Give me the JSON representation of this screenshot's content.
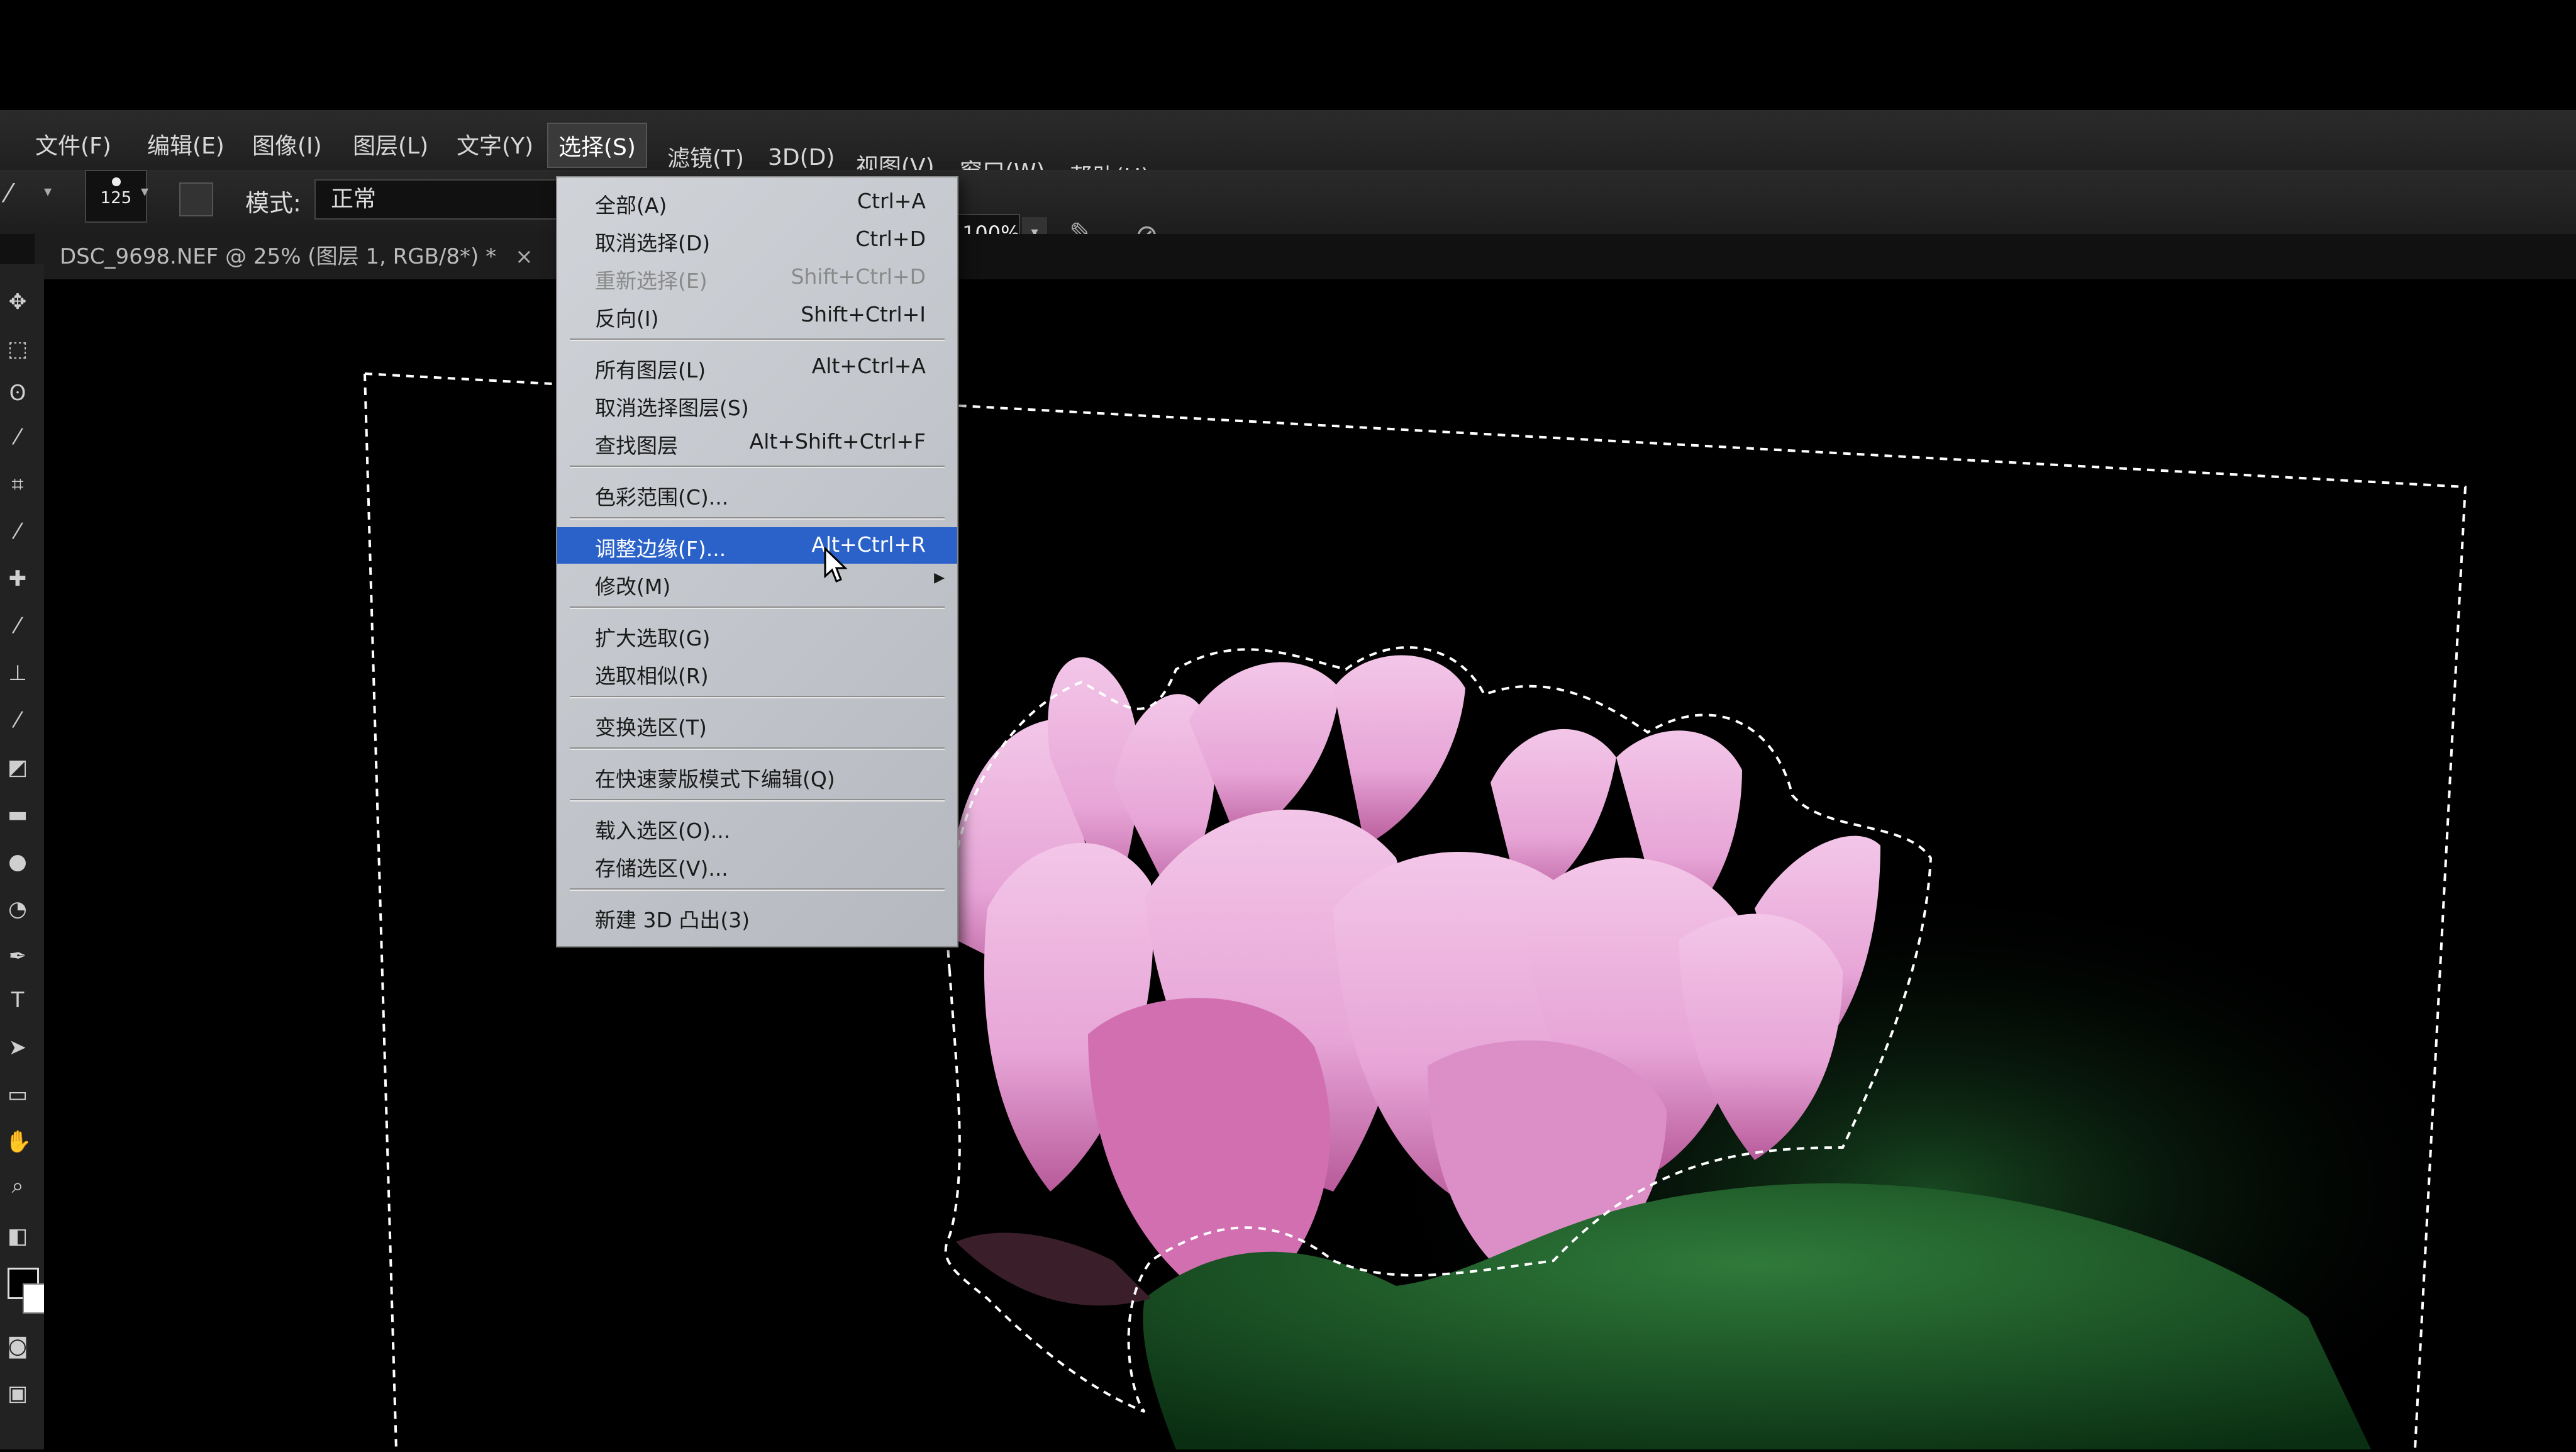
{
  "menubar": {
    "items": [
      "文件(F)",
      "编辑(E)",
      "图像(I)",
      "图层(L)",
      "文字(Y)",
      "选择(S)",
      "滤镜(T)",
      "3D(D)",
      "视图(V)",
      "窗口(W)",
      "帮助(H)"
    ]
  },
  "options_bar": {
    "brush_size": "125",
    "mode_label": "模式:",
    "mode_value": "正常",
    "opacity_value": "100%"
  },
  "document_tab": {
    "title": "DSC_9698.NEF @ 25% (图层 1, RGB/8*) *",
    "close": "×"
  },
  "select_menu": {
    "items": [
      {
        "label": "全部(A)",
        "shortcut": "Ctrl+A"
      },
      {
        "label": "取消选择(D)",
        "shortcut": "Ctrl+D"
      },
      {
        "label": "重新选择(E)",
        "shortcut": "Shift+Ctrl+D"
      },
      {
        "label": "反向(I)",
        "shortcut": "Shift+Ctrl+I"
      },
      {
        "label": "所有图层(L)",
        "shortcut": "Alt+Ctrl+A"
      },
      {
        "label": "取消选择图层(S)",
        "shortcut": ""
      },
      {
        "label": "查找图层",
        "shortcut": "Alt+Shift+Ctrl+F"
      },
      {
        "label": "色彩范围(C)...",
        "shortcut": ""
      },
      {
        "label": "调整边缘(F)...",
        "shortcut": "Alt+Ctrl+R"
      },
      {
        "label": "修改(M)",
        "shortcut": ""
      },
      {
        "label": "扩大选取(G)",
        "shortcut": ""
      },
      {
        "label": "选取相似(R)",
        "shortcut": ""
      },
      {
        "label": "变换选区(T)",
        "shortcut": ""
      },
      {
        "label": "在快速蒙版模式下编辑(Q)",
        "shortcut": ""
      },
      {
        "label": "载入选区(O)...",
        "shortcut": ""
      },
      {
        "label": "存储选区(V)...",
        "shortcut": ""
      },
      {
        "label": "新建 3D 凸出(3)",
        "shortcut": ""
      }
    ]
  },
  "toolbox": {
    "text_tool_glyph": "T"
  },
  "colors": {
    "menu_highlight": "#2a62c9",
    "petal_pink": "#e9a6d6",
    "leaf_green": "#1f5a2b"
  }
}
